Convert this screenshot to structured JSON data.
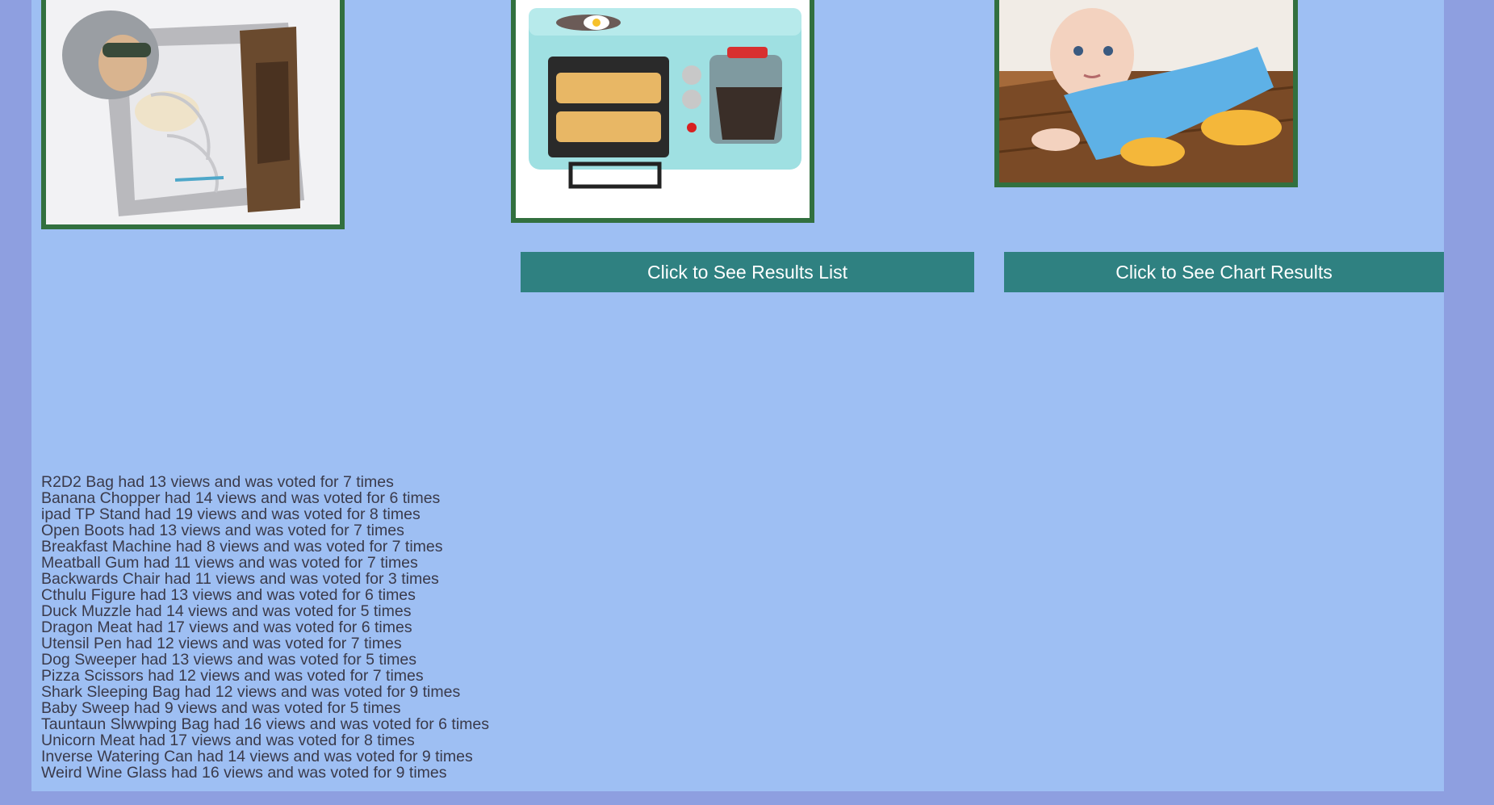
{
  "products": [
    {
      "name": "sleeping-bag-photo",
      "icon": "tauntaun-sleeping-bag"
    },
    {
      "name": "breakfast-machine-photo",
      "icon": "breakfast-machine"
    },
    {
      "name": "baby-sweep-photo",
      "icon": "baby-sweep"
    }
  ],
  "buttons": {
    "results_list": "Click to See Results List",
    "chart_results": "Click to See Chart Results"
  },
  "results": [
    "R2D2 Bag had 13 views and was voted for 7 times",
    "Banana Chopper had 14 views and was voted for 6 times",
    "ipad TP Stand had 19 views and was voted for 8 times",
    "Open Boots had 13 views and was voted for 7 times",
    "Breakfast Machine had 8 views and was voted for 7 times",
    "Meatball Gum had 11 views and was voted for 7 times",
    "Backwards Chair had 11 views and was voted for 3 times",
    "Cthulu Figure had 13 views and was voted for 6 times",
    "Duck Muzzle had 14 views and was voted for 5 times",
    "Dragon Meat had 17 views and was voted for 6 times",
    "Utensil Pen had 12 views and was voted for 7 times",
    "Dog Sweeper had 13 views and was voted for 5 times",
    "Pizza Scissors had 12 views and was voted for 7 times",
    "Shark Sleeping Bag had 12 views and was voted for 9 times",
    "Baby Sweep had 9 views and was voted for 5 times",
    "Tauntaun Slwwping Bag had 16 views and was voted for 6 times",
    "Unicorn Meat had 17 views and was voted for 8 times",
    "Inverse Watering Can had 14 views and was voted for 9 times",
    "Weird Wine Glass had 16 views and was voted for 9 times"
  ],
  "colors": {
    "outer_background": "#8e9fe0",
    "page_background": "#9ebff3",
    "button": "#2f8181",
    "image_border": "#32703f",
    "text": "#3a3a4a"
  }
}
